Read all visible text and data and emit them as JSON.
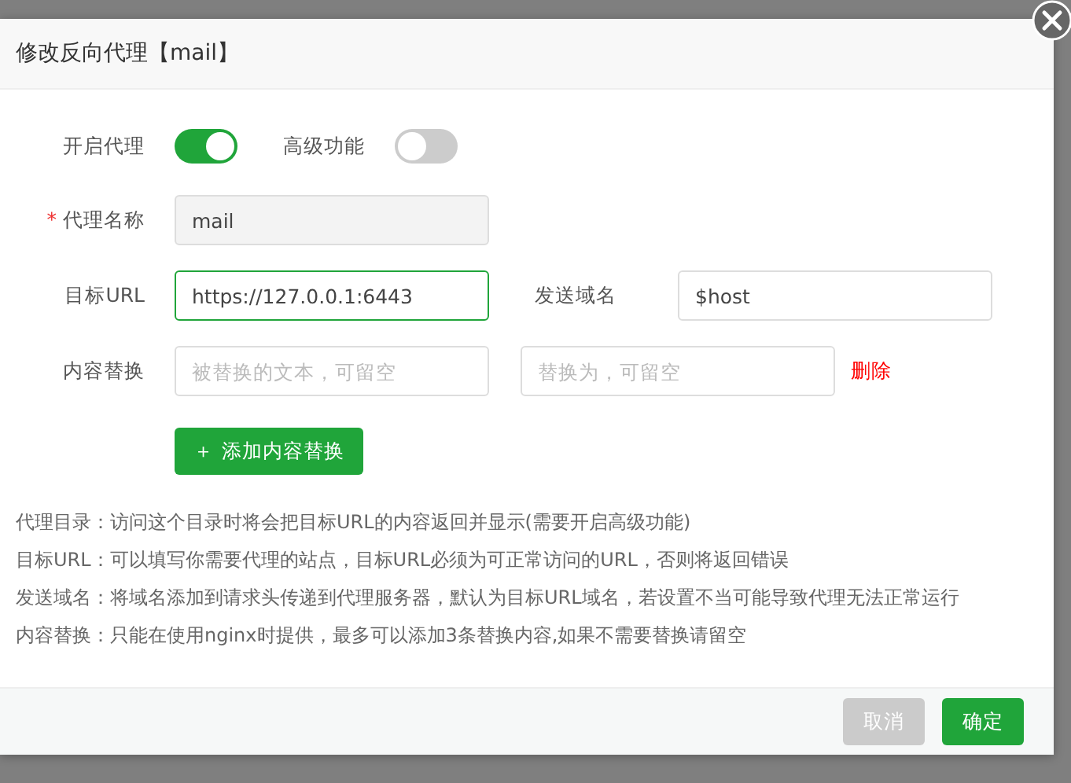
{
  "dialog": {
    "title": "修改反向代理【mail】"
  },
  "required_mark": "*",
  "switches": [
    {
      "label": "开启代理",
      "on": true
    },
    {
      "label": "高级功能",
      "on": false
    }
  ],
  "rows": [
    {
      "items": [
        {
          "kind": "label",
          "text": "代理名称",
          "required": true
        },
        {
          "kind": "input",
          "value": "mail",
          "disabled": true,
          "focused": false
        }
      ]
    },
    {
      "items": [
        {
          "kind": "label",
          "text": "目标URL",
          "required": false
        },
        {
          "kind": "input",
          "value": "https://127.0.0.1:6443",
          "disabled": false,
          "focused": true
        },
        {
          "kind": "label",
          "text": "发送域名",
          "required": false
        },
        {
          "kind": "input",
          "value": "$host",
          "disabled": false,
          "focused": false
        }
      ]
    },
    {
      "items": [
        {
          "kind": "label",
          "text": "内容替换",
          "required": false
        },
        {
          "kind": "input",
          "placeholder": "被替换的文本，可留空",
          "disabled": false,
          "focused": false
        },
        {
          "kind": "input",
          "placeholder": "替换为，可留空",
          "disabled": false,
          "focused": false
        },
        {
          "kind": "link",
          "text": "删除"
        }
      ]
    }
  ],
  "add_button": {
    "icon": "＋",
    "label": "添加内容替换"
  },
  "help": [
    "代理目录：访问这个目录时将会把目标URL的内容返回并显示(需要开启高级功能)",
    "目标URL：可以填写你需要代理的站点，目标URL必须为可正常访问的URL，否则将返回错误",
    "发送域名：将域名添加到请求头传递到代理服务器，默认为目标URL域名，若设置不当可能导致代理无法正常运行",
    "内容替换：只能在使用nginx时提供，最多可以添加3条替换内容,如果不需要替换请留空"
  ],
  "buttons": [
    {
      "label": "取消",
      "kind": "secondary"
    },
    {
      "label": "确定",
      "kind": "primary"
    }
  ]
}
